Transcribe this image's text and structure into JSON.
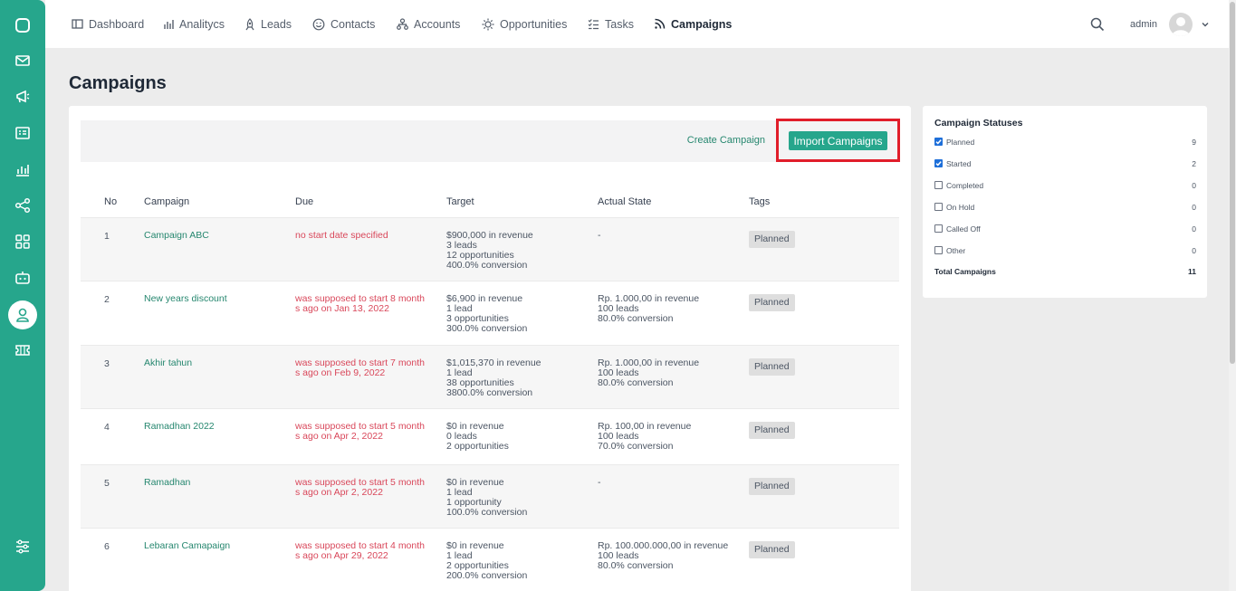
{
  "sidebar": {
    "items": [
      {
        "icon": "chat-icon"
      },
      {
        "icon": "mail-icon"
      },
      {
        "icon": "megaphone-icon"
      },
      {
        "icon": "id-card-icon"
      },
      {
        "icon": "bar-chart-icon"
      },
      {
        "icon": "share-nodes-icon"
      },
      {
        "icon": "grid-icon"
      },
      {
        "icon": "robot-icon"
      },
      {
        "icon": "user-icon"
      },
      {
        "icon": "ticket-icon"
      },
      {
        "icon": "sliders-icon"
      }
    ],
    "active_icon": "user-icon"
  },
  "nav": {
    "items": [
      {
        "label": "Dashboard",
        "icon": "layout-icon"
      },
      {
        "label": "Analitycs",
        "icon": "bar-chart-icon"
      },
      {
        "label": "Leads",
        "icon": "rocket-icon"
      },
      {
        "label": "Contacts",
        "icon": "smile-icon"
      },
      {
        "label": "Accounts",
        "icon": "org-chart-icon"
      },
      {
        "label": "Opportunities",
        "icon": "sun-icon"
      },
      {
        "label": "Tasks",
        "icon": "checklist-icon"
      },
      {
        "label": "Campaigns",
        "icon": "rss-icon"
      }
    ],
    "active": "Campaigns",
    "user": "admin"
  },
  "page": {
    "title": "Campaigns"
  },
  "toolbar": {
    "create_label": "Create Campaign",
    "import_label": "Import Campaigns"
  },
  "table": {
    "headers": [
      "No",
      "Campaign",
      "Due",
      "Target",
      "Actual State",
      "Tags"
    ],
    "rows": [
      {
        "no": "1",
        "name": "Campaign ABC",
        "due": "no start date specified",
        "target": [
          "$900,000 in revenue",
          "3 leads",
          "12 opportunities",
          "400.0% conversion"
        ],
        "actual": [
          "-"
        ],
        "tag": "Planned"
      },
      {
        "no": "2",
        "name": "New years discount",
        "due": "was supposed to start 8 months ago on Jan 13, 2022",
        "target": [
          "$6,900 in revenue",
          "1 lead",
          "3 opportunities",
          "300.0% conversion"
        ],
        "actual": [
          "Rp. 1.000,00 in revenue",
          "100 leads",
          "80.0% conversion"
        ],
        "tag": "Planned"
      },
      {
        "no": "3",
        "name": "Akhir tahun",
        "due": "was supposed to start 7 months ago on Feb 9, 2022",
        "target": [
          "$1,015,370 in revenue",
          "1 lead",
          "38 opportunities",
          "3800.0% conversion"
        ],
        "actual": [
          "Rp. 1.000,00 in revenue",
          "100 leads",
          "80.0% conversion"
        ],
        "tag": "Planned"
      },
      {
        "no": "4",
        "name": "Ramadhan 2022",
        "due": "was supposed to start 5 months ago on Apr 2, 2022",
        "target": [
          "$0 in revenue",
          "0 leads",
          "2 opportunities"
        ],
        "actual": [
          "Rp. 100,00 in revenue",
          "100 leads",
          "70.0% conversion"
        ],
        "tag": "Planned"
      },
      {
        "no": "5",
        "name": "Ramadhan",
        "due": "was supposed to start 5 months ago on Apr 2, 2022",
        "target": [
          "$0 in revenue",
          "1 lead",
          "1 opportunity",
          "100.0% conversion"
        ],
        "actual": [
          "-"
        ],
        "tag": "Planned"
      },
      {
        "no": "6",
        "name": "Lebaran Camapaign",
        "due": "was supposed to start 4 months ago on Apr 29, 2022",
        "target": [
          "$0 in revenue",
          "1 lead",
          "2 opportunities",
          "200.0% conversion"
        ],
        "actual": [
          "Rp. 100.000.000,00 in revenue",
          "100 leads",
          "80.0% conversion"
        ],
        "tag": "Planned"
      }
    ]
  },
  "statuses": {
    "title": "Campaign Statuses",
    "items": [
      {
        "label": "Planned",
        "count": "9",
        "checked": true
      },
      {
        "label": "Started",
        "count": "2",
        "checked": true
      },
      {
        "label": "Completed",
        "count": "0",
        "checked": false
      },
      {
        "label": "On Hold",
        "count": "0",
        "checked": false
      },
      {
        "label": "Called Off",
        "count": "0",
        "checked": false
      },
      {
        "label": "Other",
        "count": "0",
        "checked": false
      }
    ],
    "total_label": "Total Campaigns",
    "total_count": "11"
  },
  "colors": {
    "brand": "#26a68c",
    "link": "#26876f",
    "due_text": "#d9475a",
    "highlight": "#e11d2a"
  }
}
